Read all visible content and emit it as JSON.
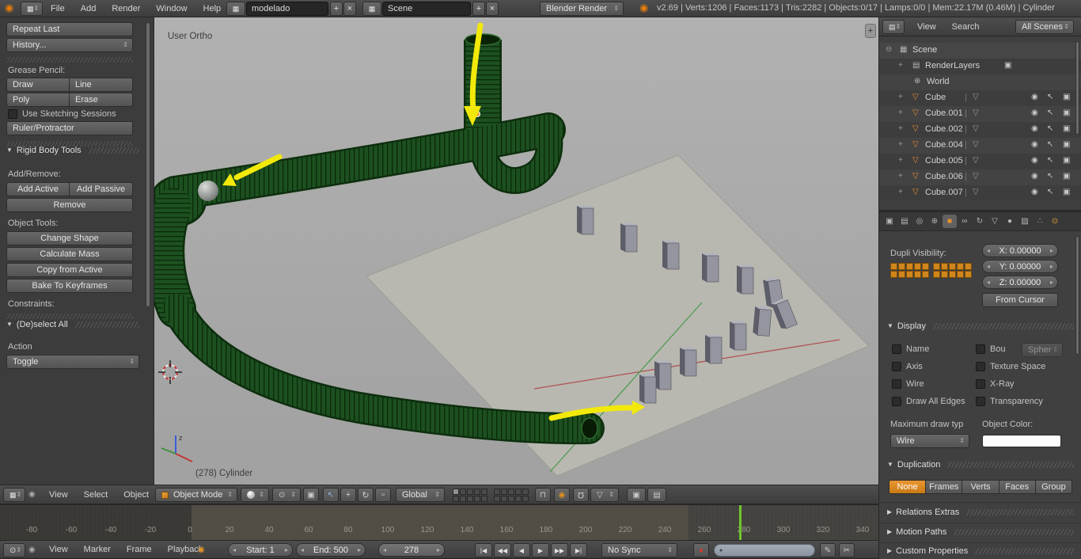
{
  "top_header": {
    "menus": [
      "File",
      "Add",
      "Render",
      "Window",
      "Help"
    ],
    "layout_field": "modelado",
    "scene_field": "Scene",
    "engine_select": "Blender Render",
    "stats": "v2.69 | Verts:1206 | Faces:1173 | Tris:2282 | Objects:0/17 | Lamps:0/0 | Mem:22.17M (0.46M) | Cylinder"
  },
  "tool_shelf": {
    "headers": {
      "rigid_body": "Rigid Body Tools",
      "deselect": "(De)select All"
    },
    "labels": {
      "grease_pencil": "Grease Pencil:",
      "sketching": "Use Sketching Sessions",
      "add_remove": "Add/Remove:",
      "object_tools": "Object Tools:",
      "constraints": "Constraints:",
      "action": "Action"
    },
    "buttons": {
      "repeat_last": "Repeat Last",
      "history": "History...",
      "draw": "Draw",
      "line": "Line",
      "poly": "Poly",
      "erase": "Erase",
      "ruler": "Ruler/Protractor",
      "add_active": "Add Active",
      "add_passive": "Add Passive",
      "remove": "Remove",
      "change_shape": "Change Shape",
      "calculate_mass": "Calculate Mass",
      "copy_from_active": "Copy from Active",
      "bake_to_keyframes": "Bake To Keyframes",
      "toggle": "Toggle"
    }
  },
  "viewport": {
    "view_label": "User Ortho",
    "status_label": "(278) Cylinder"
  },
  "vp_header": {
    "menus": [
      "View",
      "Select",
      "Object"
    ],
    "mode_select": "Object Mode",
    "orientation_select": "Global"
  },
  "outliner": {
    "menus": [
      "View",
      "Search"
    ],
    "scenes_select": "All Scenes",
    "root": "Scene",
    "children": [
      "RenderLayers",
      "World"
    ],
    "cubes": [
      "Cube",
      "Cube.001",
      "Cube.002",
      "Cube.004",
      "Cube.005",
      "Cube.006",
      "Cube.007"
    ]
  },
  "props": {
    "dupli_label": "Dupli Visibility:",
    "x_field": "X: 0.00000",
    "y_field": "Y: 0.00000",
    "z_field": "Z: 0.00000",
    "from_cursor": "From Cursor",
    "display": {
      "header": "Display",
      "left": [
        "Name",
        "Axis",
        "Wire",
        "Draw All Edges"
      ],
      "right": [
        "Bou",
        "Texture Space",
        "X-Ray",
        "Transparency"
      ],
      "spher_btn": "Spher",
      "max_draw_label": "Maximum draw typ",
      "object_color_label": "Object Color:",
      "draw_type_select": "Wire"
    },
    "duplication": {
      "header": "Duplication",
      "options": [
        "None",
        "Frames",
        "Verts",
        "Faces",
        "Group"
      ],
      "active": "None"
    },
    "collapsed_panels": [
      "Relations Extras",
      "Motion Paths",
      "Custom Properties"
    ]
  },
  "timeline": {
    "ticks": [
      "-80",
      "-60",
      "-40",
      "-20",
      "0",
      "20",
      "40",
      "60",
      "80",
      "100",
      "120",
      "140",
      "160",
      "180",
      "200",
      "220",
      "240",
      "260",
      "280",
      "300",
      "320",
      "340"
    ],
    "menus": [
      "View",
      "Marker",
      "Frame",
      "Playback"
    ],
    "start_field": "Start: 1",
    "end_field": "End: 500",
    "frame_field": "278",
    "sync_select": "No Sync"
  },
  "icons": {
    "logo": "◉",
    "grid": "▦",
    "list": "▤",
    "clock": "⊙",
    "pin": "◉",
    "plus": "+",
    "close": "×",
    "updown": "⇕",
    "down": "▾",
    "left_arrow": "◂",
    "right_arrow": "▸",
    "tri_open": "▼",
    "tri_closed": "▶",
    "mesh": "▽",
    "world": "⊕",
    "scene_dot": "⊖",
    "camera": "▣",
    "eye": "◉",
    "cursor": "↖",
    "sep": "|",
    "pivot": "⊙",
    "align": "▣",
    "pointer": "↖",
    "translate": "+",
    "rotate": "↻",
    "scale": "▫",
    "lock": "⊓",
    "prop_edit": "◉",
    "magnet": "Ω",
    "snap": "▽",
    "ogl_render": "▣",
    "ogl_anim": "▤",
    "record": "●",
    "pen": "✎",
    "scissors": "✂",
    "key_dot": "●",
    "playback": [
      "|◀",
      "◀◀",
      "◀",
      "▶",
      "▶▶",
      "▶|"
    ],
    "prop_tabs": [
      "▣",
      "▤",
      "◎",
      "⊕",
      "■",
      "∞",
      "↻",
      "▽",
      "●",
      "▨",
      "∴",
      "⊙"
    ]
  }
}
